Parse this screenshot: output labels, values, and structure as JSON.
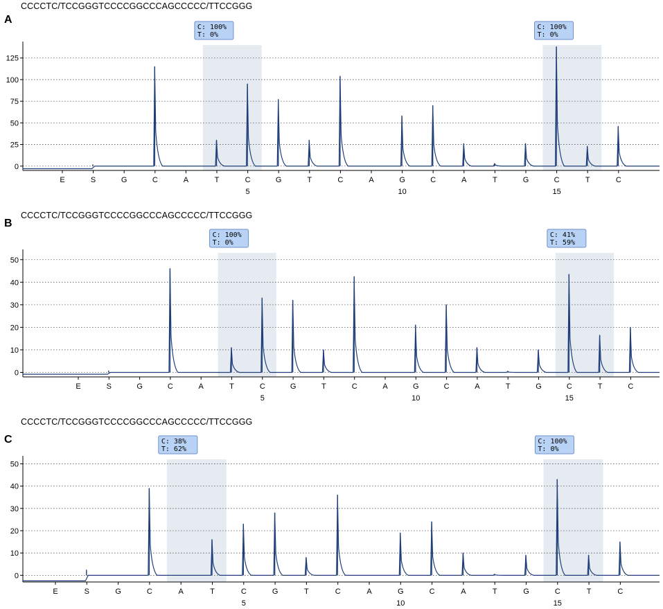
{
  "sequence": "CCCCTC/TCCGGGTCCCCGGCCCAGCCCCC/TTCCGGG",
  "colors": {
    "trace": "#1f3f7a",
    "highlight": "#e6ebf1",
    "badge_fill": "#b9d3f7",
    "badge_border": "#6e8fc7"
  },
  "chart_data": [
    {
      "type": "line",
      "panel_label": "A",
      "sequence": "CCCCTC/TCCGGGTCCCCGGCCCAGCCCCC/TTCCGGG",
      "dispensation_order": [
        "E",
        "S",
        "G",
        "C",
        "A",
        "T",
        "C",
        "G",
        "T",
        "C",
        "A",
        "G",
        "C",
        "A",
        "T",
        "G",
        "C",
        "T",
        "C"
      ],
      "position_labels": [
        {
          "index": 6,
          "label": "5"
        },
        {
          "index": 11,
          "label": "10"
        },
        {
          "index": 16,
          "label": "15"
        }
      ],
      "ylim": [
        -5,
        140
      ],
      "yticks": [
        0,
        25,
        50,
        75,
        100,
        125
      ],
      "peak_heights": [
        0,
        2,
        0,
        115,
        0,
        30,
        95,
        77,
        30,
        104,
        0,
        58,
        70,
        26,
        3,
        26,
        138,
        23,
        46
      ],
      "grid": "dashed-horizontal",
      "highlight_indices": [
        6,
        17
      ],
      "annotations": [
        {
          "index": 6,
          "line1": "C: 100%",
          "line2": "T: 0%"
        },
        {
          "index": 17,
          "line1": "C: 100%",
          "line2": "T: 0%"
        }
      ]
    },
    {
      "type": "line",
      "panel_label": "B",
      "sequence": "CCCCTC/TCCGGGTCCCCGGCCCAGCCCCC/TTCCGGG",
      "dispensation_order": [
        "E",
        "S",
        "G",
        "C",
        "A",
        "T",
        "C",
        "G",
        "T",
        "C",
        "A",
        "G",
        "C",
        "A",
        "T",
        "G",
        "C",
        "T",
        "C"
      ],
      "position_labels": [
        {
          "index": 6,
          "label": "5"
        },
        {
          "index": 11,
          "label": "10"
        },
        {
          "index": 16,
          "label": "15"
        }
      ],
      "ylim": [
        -2,
        53
      ],
      "yticks": [
        0,
        10,
        20,
        30,
        40,
        50
      ],
      "peak_heights": [
        0,
        0.8,
        0,
        46,
        0,
        11,
        33,
        32,
        10,
        42.5,
        0,
        21,
        30,
        11,
        0.5,
        10,
        43.5,
        16.5,
        20
      ],
      "grid": "dashed-horizontal",
      "highlight_indices": [
        6,
        17
      ],
      "annotations": [
        {
          "index": 6,
          "line1": "C: 100%",
          "line2": "T: 0%"
        },
        {
          "index": 17,
          "line1": "C: 41%",
          "line2": "T: 59%"
        }
      ]
    },
    {
      "type": "line",
      "panel_label": "C",
      "sequence": "CCCCTC/TCCGGGTCCCCGGCCCAGCCCCC/TTCCGGG",
      "dispensation_order": [
        "E",
        "S",
        "G",
        "C",
        "A",
        "T",
        "C",
        "G",
        "T",
        "C",
        "A",
        "G",
        "C",
        "A",
        "T",
        "G",
        "C",
        "T",
        "C"
      ],
      "position_labels": [
        {
          "index": 6,
          "label": "5"
        },
        {
          "index": 11,
          "label": "10"
        },
        {
          "index": 16,
          "label": "15"
        }
      ],
      "ylim": [
        -3,
        52
      ],
      "yticks": [
        0,
        10,
        20,
        30,
        40,
        50
      ],
      "peak_heights": [
        0,
        2.5,
        0,
        39,
        0,
        16,
        23,
        28,
        8,
        36,
        0,
        19,
        24,
        10,
        0.5,
        9,
        43,
        9,
        15
      ],
      "grid": "dashed-horizontal",
      "highlight_indices": [
        5,
        17
      ],
      "annotations": [
        {
          "index": 5,
          "line1": "C: 38%",
          "line2": "T: 62%"
        },
        {
          "index": 17,
          "line1": "C: 100%",
          "line2": "T: 0%"
        }
      ]
    }
  ]
}
